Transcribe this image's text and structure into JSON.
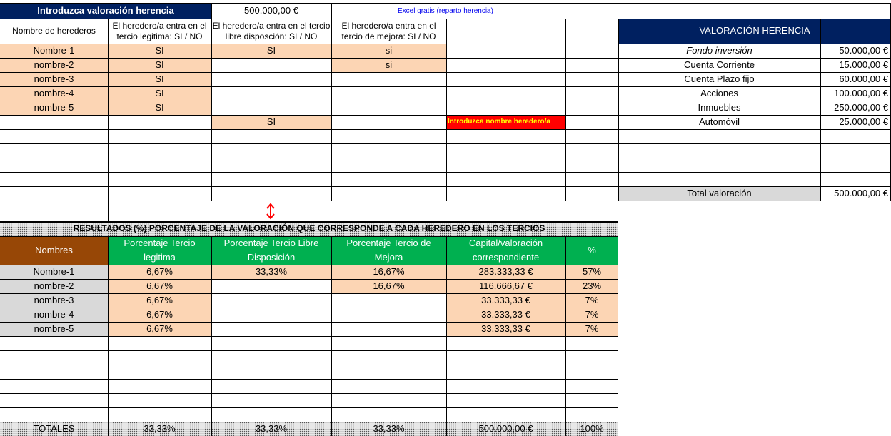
{
  "header": {
    "title": "Introduzca valoración herencia",
    "amount": "500.000,00 €",
    "link": "Excel gratis (reparto herencia)"
  },
  "table1": {
    "columns": [
      "Nombre de herederos",
      "El heredero/a entra en el tercio legitima: SI / NO",
      "El heredero/a entra en el tercio libre disposción: SI / NO",
      "El heredero/a entra en el tercio de mejora:  SI / NO"
    ],
    "rows": [
      [
        "Nombre-1",
        "SI",
        "SI",
        "si"
      ],
      [
        "nombre-2",
        "SI",
        "",
        "si"
      ],
      [
        "nombre-3",
        "SI",
        "",
        ""
      ],
      [
        "nombre-4",
        "SI",
        "",
        ""
      ],
      [
        "nombre-5",
        "SI",
        "",
        ""
      ],
      [
        "",
        "",
        "SI",
        ""
      ]
    ],
    "warning": "Introduzca nombre heredero/a"
  },
  "valoracion": {
    "title": "VALORACIÓN HERENCIA",
    "items": [
      {
        "name": "Fondo inversión",
        "value": "50.000,00 €"
      },
      {
        "name": "Cuenta Corriente",
        "value": "15.000,00 €"
      },
      {
        "name": "Cuenta Plazo fijo",
        "value": "60.000,00 €"
      },
      {
        "name": "Acciones",
        "value": "100.000,00 €"
      },
      {
        "name": "Inmuebles",
        "value": "250.000,00 €"
      },
      {
        "name": "Automóvil",
        "value": "25.000,00 €"
      }
    ],
    "total_label": "Total valoración",
    "total_value": "500.000,00 €"
  },
  "results": {
    "banner": "RESULTADOS (%) PORCENTAJE DE LA VALORACIÓN QUE CORRESPONDE A CADA HEREDERO EN LOS TERCIOS",
    "headers": [
      "Nombres",
      "Porcentaje Tercio legitima",
      "Porcentaje Tercio  Libre Disposición",
      "Porcentaje  Tercio de Mejora",
      "Capital/valoración correspondiente",
      "%"
    ],
    "rows": [
      [
        "Nombre-1",
        "6,67%",
        "33,33%",
        "16,67%",
        "283.333,33 €",
        "57%"
      ],
      [
        "nombre-2",
        "6,67%",
        "",
        "16,67%",
        "116.666,67 €",
        "23%"
      ],
      [
        "nombre-3",
        "6,67%",
        "",
        "",
        "33.333,33 €",
        "7%"
      ],
      [
        "nombre-4",
        "6,67%",
        "",
        "",
        "33.333,33 €",
        "7%"
      ],
      [
        "nombre-5",
        "6,67%",
        "",
        "",
        "33.333,33 €",
        "7%"
      ]
    ],
    "totals": [
      "TOTALES",
      "33,33%",
      "33,33%",
      "33,33%",
      "500.000,00 €",
      "100%"
    ]
  },
  "colors": {
    "navy": "#002060",
    "peach": "#fcd5b4",
    "green": "#00b050",
    "brown": "#974706",
    "warning_bg": "#ff0000",
    "warning_text": "#ffff00",
    "arrow": "#ff0000"
  },
  "icons": {
    "arrow": "double-vertical-arrow-icon"
  }
}
